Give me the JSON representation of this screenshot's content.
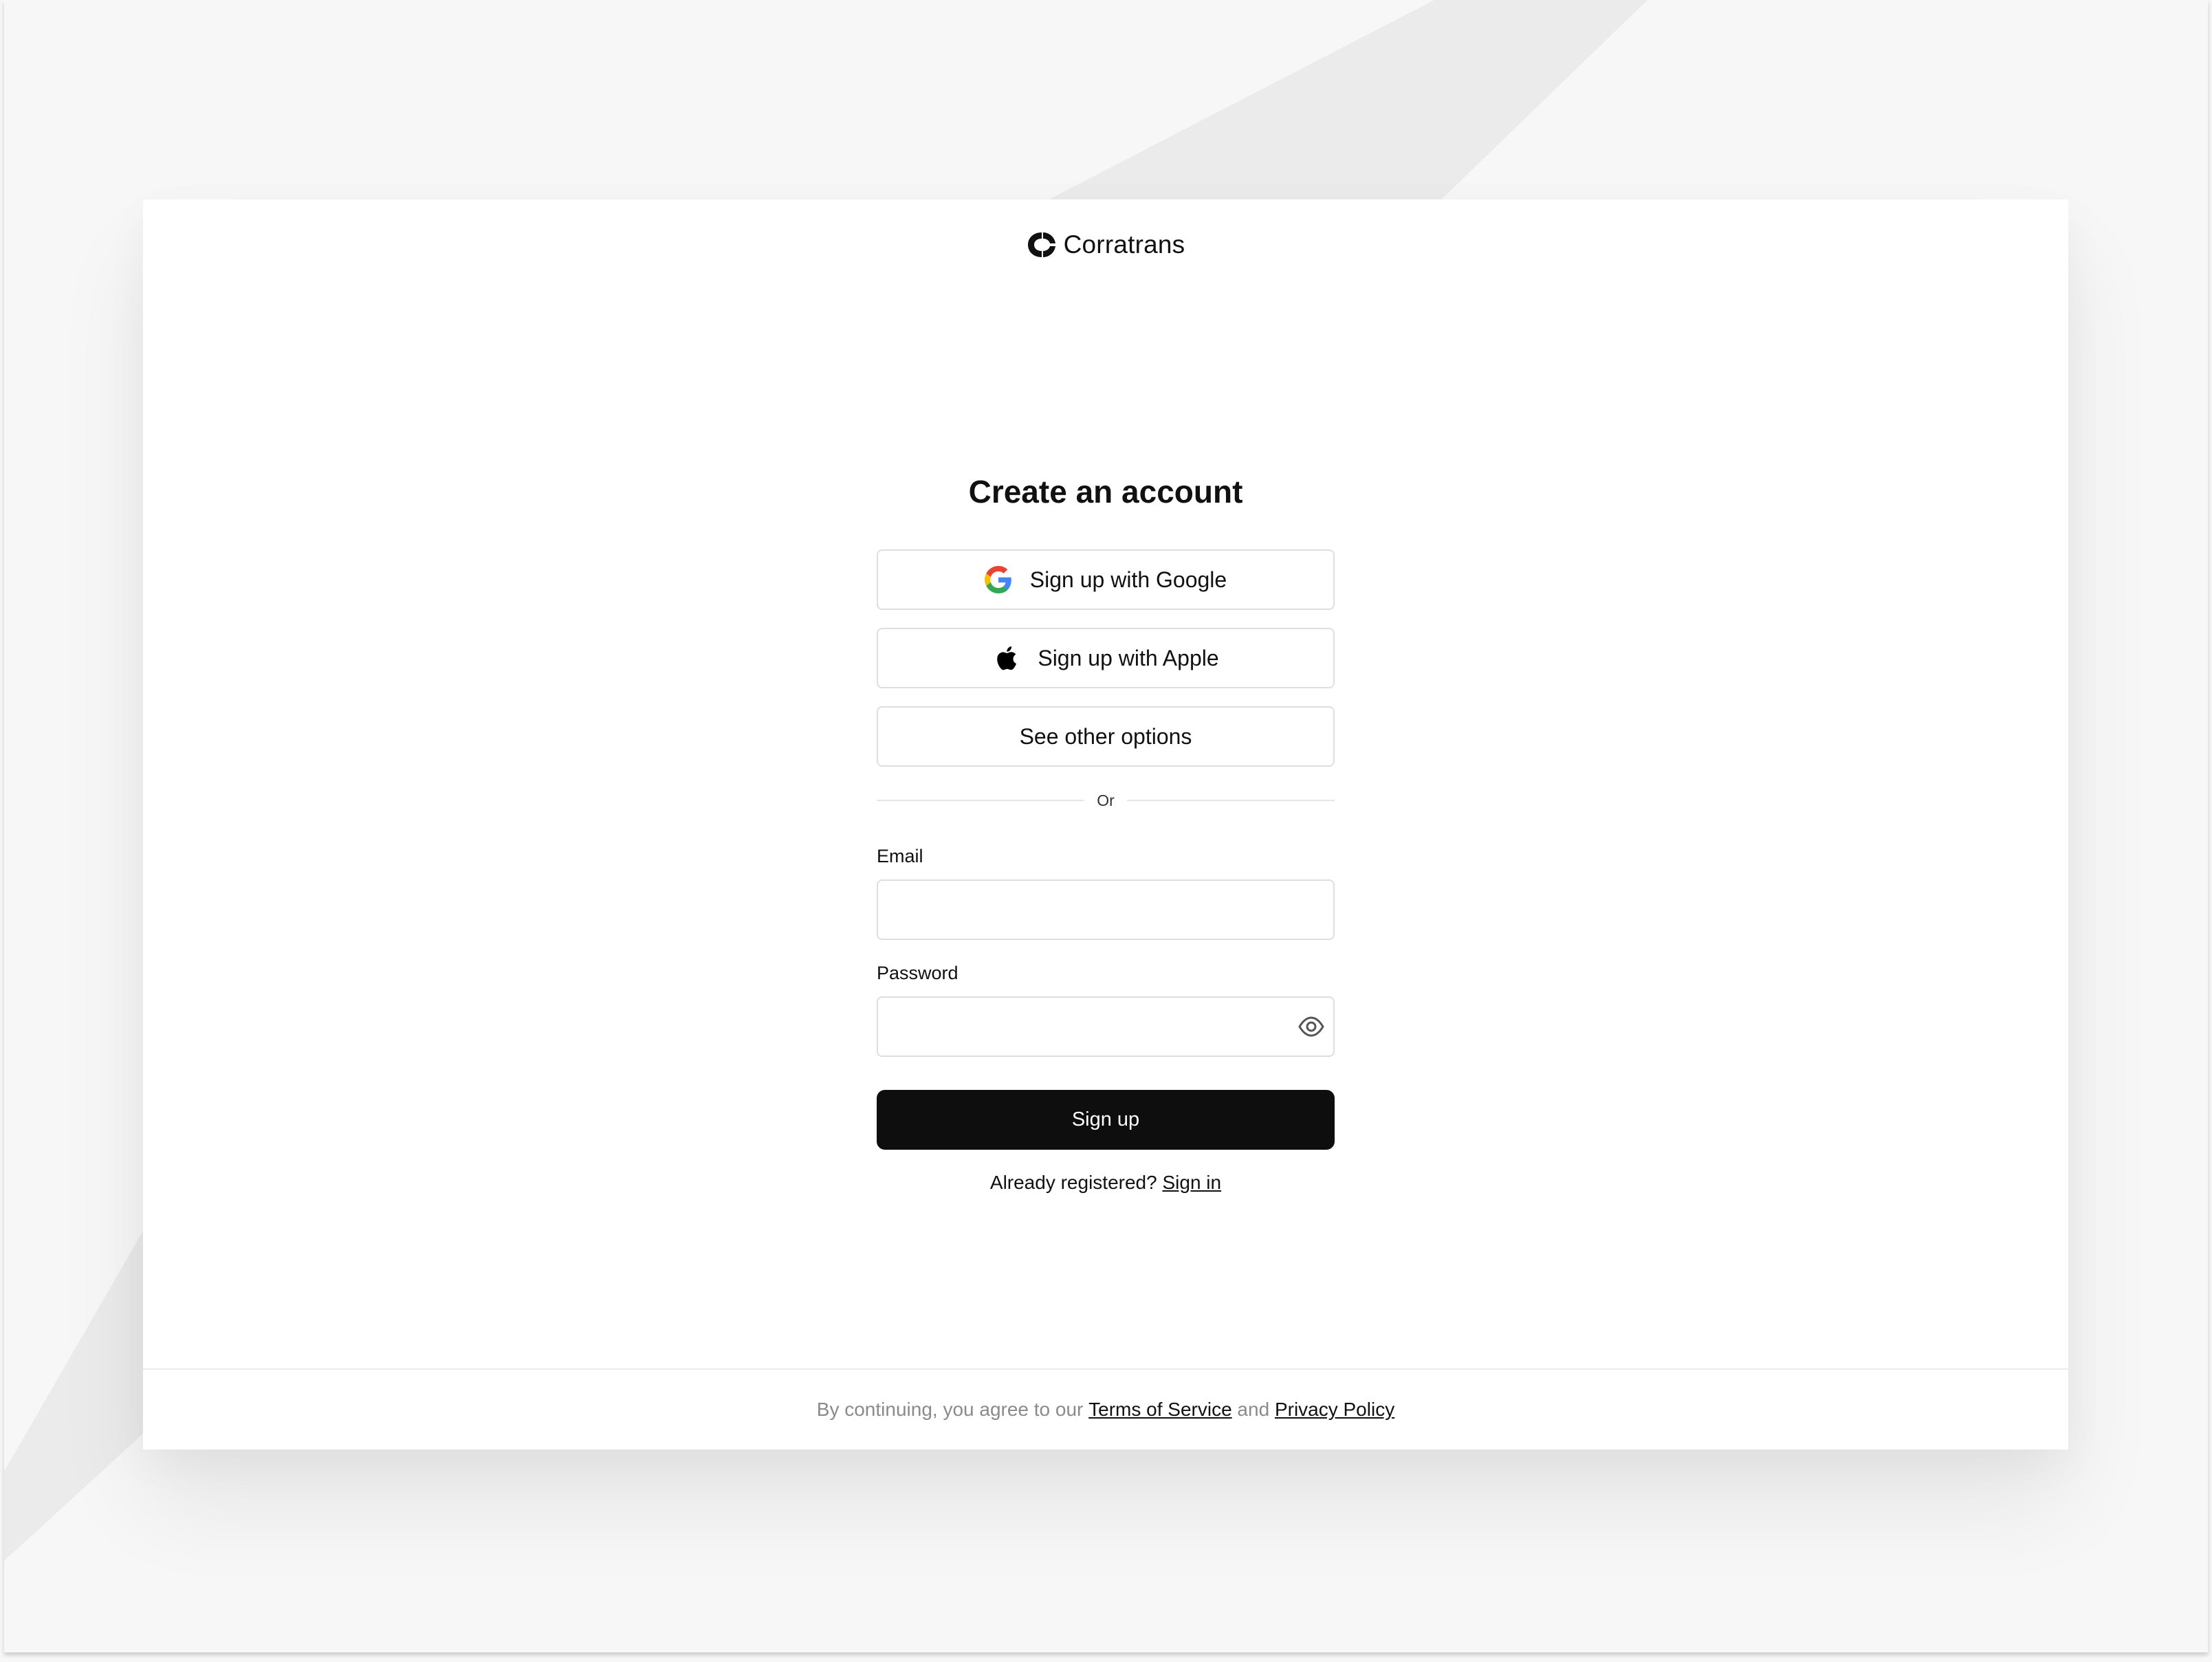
{
  "brand": {
    "name": "Corratrans",
    "logo_icon": "corratrans-logo-icon"
  },
  "signup": {
    "title": "Create an account",
    "google_label": "Sign up with Google",
    "apple_label": "Sign up with Apple",
    "other_label": "See other options",
    "divider_label": "Or",
    "email_label": "Email",
    "email_value": "",
    "password_label": "Password",
    "password_value": "",
    "submit_label": "Sign up",
    "already_text": "Already registered? ",
    "signin_label": "Sign in"
  },
  "footer": {
    "prefix": "By continuing, you agree to our ",
    "terms_label": "Terms of Service",
    "and_text": " and ",
    "privacy_label": "Privacy Policy"
  },
  "colors": {
    "primary_button": "#0e0e0e",
    "border": "#dedede",
    "muted_text": "#8a8a8a",
    "page_background": "#f7f7f7"
  }
}
